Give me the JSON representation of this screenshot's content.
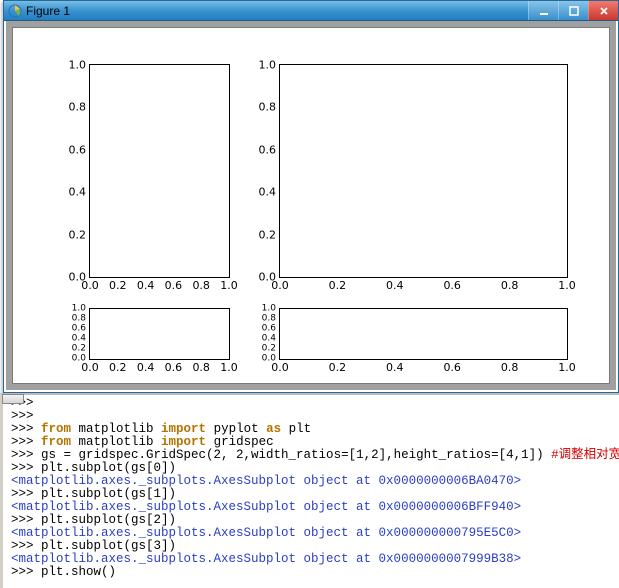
{
  "window": {
    "title": "Figure 1",
    "min_btn": "_",
    "max_btn": "□",
    "close_btn": "×"
  },
  "chart_data": [
    {
      "type": "subplot",
      "grid_pos": [
        0,
        0
      ],
      "width_ratio": 1,
      "height_ratio": 4,
      "xlim": [
        0.0,
        1.0
      ],
      "ylim": [
        0.0,
        1.0
      ],
      "xticks": [
        "0.0",
        "0.2",
        "0.4",
        "0.6",
        "0.8",
        "1.0"
      ],
      "yticks": [
        "0.0",
        "0.2",
        "0.4",
        "0.6",
        "0.8",
        "1.0"
      ]
    },
    {
      "type": "subplot",
      "grid_pos": [
        0,
        1
      ],
      "width_ratio": 2,
      "height_ratio": 4,
      "xlim": [
        0.0,
        1.0
      ],
      "ylim": [
        0.0,
        1.0
      ],
      "xticks": [
        "0.0",
        "0.2",
        "0.4",
        "0.6",
        "0.8",
        "1.0"
      ],
      "yticks": [
        "0.0",
        "0.2",
        "0.4",
        "0.6",
        "0.8",
        "1.0"
      ]
    },
    {
      "type": "subplot",
      "grid_pos": [
        1,
        0
      ],
      "width_ratio": 1,
      "height_ratio": 1,
      "xlim": [
        0.0,
        1.0
      ],
      "ylim": [
        0.0,
        1.0
      ],
      "xticks": [
        "0.0",
        "0.2",
        "0.4",
        "0.6",
        "0.8",
        "1.0"
      ],
      "yticks": [
        "0.0",
        "0.2",
        "0.4",
        "0.6",
        "0.8",
        "1.0"
      ]
    },
    {
      "type": "subplot",
      "grid_pos": [
        1,
        1
      ],
      "width_ratio": 2,
      "height_ratio": 1,
      "xlim": [
        0.0,
        1.0
      ],
      "ylim": [
        0.0,
        1.0
      ],
      "xticks": [
        "0.0",
        "0.2",
        "0.4",
        "0.6",
        "0.8",
        "1.0"
      ],
      "yticks": [
        "0.0",
        "0.2",
        "0.4",
        "0.6",
        "0.8",
        "1.0"
      ]
    }
  ],
  "gridspec": {
    "rows": 2,
    "cols": 2,
    "width_ratios": [
      1,
      2
    ],
    "height_ratios": [
      4,
      1
    ]
  },
  "console": {
    "lines": [
      {
        "kind": "prompt_blank",
        "text": ">>>"
      },
      {
        "kind": "prompt_blank",
        "text": ">>>"
      },
      {
        "kind": "code",
        "prompt": ">>> ",
        "seg": [
          {
            "c": "kw",
            "t": "from"
          },
          {
            "c": "text",
            "t": " matplotlib "
          },
          {
            "c": "kw",
            "t": "import"
          },
          {
            "c": "text",
            "t": " pyplot "
          },
          {
            "c": "kw",
            "t": "as"
          },
          {
            "c": "text",
            "t": " plt"
          }
        ]
      },
      {
        "kind": "code",
        "prompt": ">>> ",
        "seg": [
          {
            "c": "kw",
            "t": "from"
          },
          {
            "c": "text",
            "t": " matplotlib "
          },
          {
            "c": "kw",
            "t": "import"
          },
          {
            "c": "text",
            "t": " gridspec"
          }
        ]
      },
      {
        "kind": "code",
        "prompt": ">>> ",
        "seg": [
          {
            "c": "text",
            "t": "gs = gridspec.GridSpec(2, 2,width_ratios=[1,2],height_ratios=[4,1]) "
          },
          {
            "c": "comment",
            "t": "#调整相对宽高"
          }
        ]
      },
      {
        "kind": "code",
        "prompt": ">>> ",
        "seg": [
          {
            "c": "text",
            "t": "plt.subplot(gs[0])"
          }
        ]
      },
      {
        "kind": "output",
        "text": "<matplotlib.axes._subplots.AxesSubplot object at 0x0000000006BA0470>"
      },
      {
        "kind": "code",
        "prompt": ">>> ",
        "seg": [
          {
            "c": "text",
            "t": "plt.subplot(gs[1])"
          }
        ]
      },
      {
        "kind": "output",
        "text": "<matplotlib.axes._subplots.AxesSubplot object at 0x0000000006BFF940>"
      },
      {
        "kind": "code",
        "prompt": ">>> ",
        "seg": [
          {
            "c": "text",
            "t": "plt.subplot(gs[2])"
          }
        ]
      },
      {
        "kind": "output",
        "text": "<matplotlib.axes._subplots.AxesSubplot object at 0x000000000795E5C0>"
      },
      {
        "kind": "code",
        "prompt": ">>> ",
        "seg": [
          {
            "c": "text",
            "t": "plt.subplot(gs[3])"
          }
        ]
      },
      {
        "kind": "output",
        "text": "<matplotlib.axes._subplots.AxesSubplot object at 0x0000000007999B38>"
      },
      {
        "kind": "code",
        "prompt": ">>> ",
        "seg": [
          {
            "c": "text",
            "t": "plt.show()"
          }
        ]
      }
    ]
  }
}
